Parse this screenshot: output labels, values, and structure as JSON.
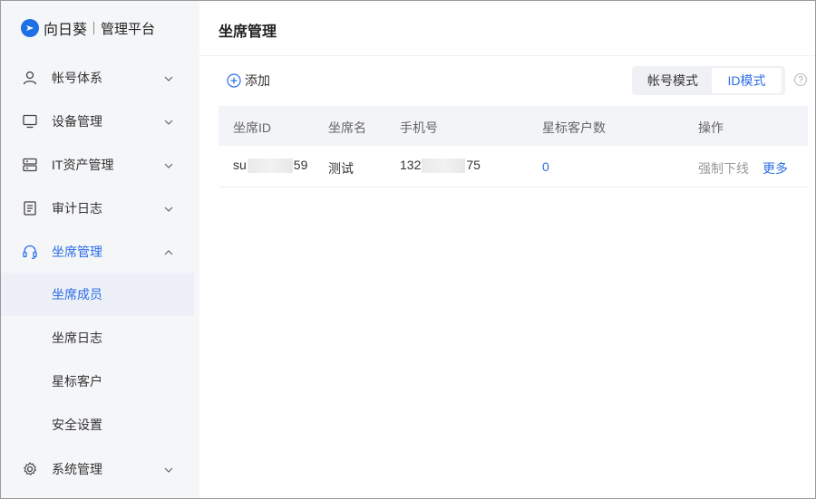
{
  "brand": {
    "name": "向日葵",
    "subtitle": "管理平台"
  },
  "sidebar": {
    "items": [
      {
        "label": "帐号体系",
        "icon": "user-icon"
      },
      {
        "label": "设备管理",
        "icon": "monitor-icon"
      },
      {
        "label": "IT资产管理",
        "icon": "server-icon"
      },
      {
        "label": "审计日志",
        "icon": "document-icon"
      },
      {
        "label": "坐席管理",
        "icon": "headset-icon"
      },
      {
        "label": "系统管理",
        "icon": "gear-icon"
      }
    ],
    "subitems": [
      {
        "label": "坐席成员"
      },
      {
        "label": "坐席日志"
      },
      {
        "label": "星标客户"
      },
      {
        "label": "安全设置"
      }
    ]
  },
  "main": {
    "title": "坐席管理",
    "add_label": "添加",
    "mode_toggle": {
      "account": "帐号模式",
      "id": "ID模式",
      "selected": "ID模式"
    }
  },
  "table": {
    "columns": [
      "坐席ID",
      "坐席名",
      "手机号",
      "星标客户数",
      "操作"
    ],
    "rows": [
      {
        "seat_id_prefix": "su",
        "seat_id_suffix": "59",
        "name": "测试",
        "phone_prefix": "132",
        "phone_suffix": "75",
        "star_count": "0",
        "action_offline": "强制下线",
        "action_more": "更多"
      }
    ]
  },
  "colors": {
    "accent": "#2c6ee8",
    "sidebar_bg": "#f5f6f8",
    "selected_bg": "#edf0f6"
  }
}
